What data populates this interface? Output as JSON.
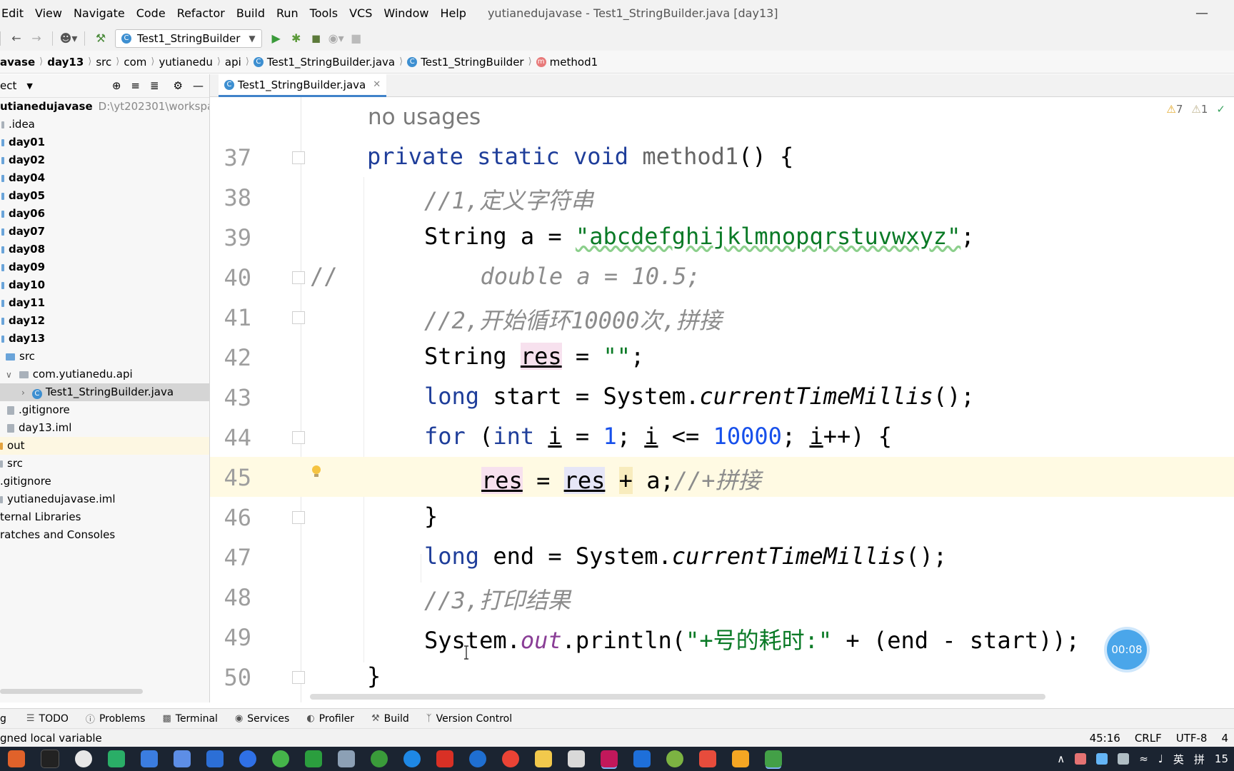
{
  "menu": {
    "items": [
      "Edit",
      "View",
      "Navigate",
      "Code",
      "Refactor",
      "Build",
      "Run",
      "Tools",
      "VCS",
      "Window",
      "Help"
    ],
    "window_title": "yutianedujavase - Test1_StringBuilder.java [day13]"
  },
  "toolbar": {
    "run_config": "Test1_StringBuilder"
  },
  "breadcrumb": [
    "avase",
    "day13",
    "src",
    "com",
    "yutianedu",
    "api",
    "Test1_StringBuilder.java",
    "Test1_StringBuilder",
    "method1"
  ],
  "project": {
    "header": "ect",
    "root_name": "utianedujavase",
    "root_path": "D:\\yt202301\\workspace\\",
    "tree": [
      ".idea",
      "day01",
      "day02",
      "day04",
      "day05",
      "day06",
      "day07",
      "day08",
      "day09",
      "day10",
      "day11",
      "day12",
      "day13",
      "src",
      "com.yutianedu.api",
      "Test1_StringBuilder.java",
      ".gitignore",
      "day13.iml",
      "out",
      "src",
      ".gitignore",
      "yutianedujavase.iml",
      "ternal Libraries",
      "ratches and Consoles"
    ]
  },
  "editor": {
    "tab": "Test1_StringBuilder.java",
    "hint": "no usages",
    "inspections": {
      "warnings": "7",
      "weak_warnings": "1"
    },
    "line_numbers": [
      "37",
      "38",
      "39",
      "40",
      "41",
      "42",
      "43",
      "44",
      "45",
      "46",
      "47",
      "48",
      "49",
      "50"
    ],
    "code": {
      "l37_kw1": "private",
      "l37_kw2": "static",
      "l37_kw3": "void",
      "l37_fn": "method1",
      "l37_rest": "() {",
      "l38_comment": "//1,定义字符串",
      "l39_type": "String a = ",
      "l39_str": "\"abcdefghijklmnopqrstuvwxyz\"",
      "l39_end": ";",
      "l40_slashes": "//",
      "l40_comment": "  double a = 10.5;",
      "l41_comment": "//2,开始循环10000次,拼接",
      "l42_a": "String ",
      "l42_res": "res",
      "l42_b": " = ",
      "l42_str": "\"\"",
      "l42_end": ";",
      "l43_kw": "long",
      "l43_a": " start = System.",
      "l43_m": "currentTimeMillis",
      "l43_end": "();",
      "l44_for": "for",
      "l44_a": " (",
      "l44_int": "int",
      "l44_sp": " ",
      "l44_i1": "i",
      "l44_b": " = ",
      "l44_n1": "1",
      "l44_c": "; ",
      "l44_i2": "i",
      "l44_d": " <= ",
      "l44_n2": "10000",
      "l44_e": "; ",
      "l44_i3": "i",
      "l44_f": "++) {",
      "l45_res1": "res",
      "l45_a": " = ",
      "l45_res2": "res",
      "l45_sp": " ",
      "l45_plus": "+",
      "l45_b": " a;",
      "l45_comment": "//+拼接",
      "l46": "}",
      "l47_kw": "long",
      "l47_a": " end = System.",
      "l47_m": "currentTimeMillis",
      "l47_end": "();",
      "l48_comment": "//3,打印结果",
      "l49_a": "System.",
      "l49_out": "out",
      "l49_b": ".println(",
      "l49_str": "\"+号的耗时:\"",
      "l49_c": " + (end - start));",
      "l50": "}"
    }
  },
  "timer": "00:08",
  "toolwindows": [
    "g",
    "TODO",
    "Problems",
    "Terminal",
    "Services",
    "Profiler",
    "Build",
    "Version Control"
  ],
  "status": {
    "message": "gned local variable",
    "position": "45:16",
    "line_sep": "CRLF",
    "encoding": "UTF-8",
    "indent": "4"
  },
  "taskbar": {
    "ime": "英",
    "ime2": "拼",
    "clock": "15"
  },
  "colors": {
    "accent": "#4083c9",
    "keyword": "#1f3e9a",
    "string": "#0a7a26",
    "number": "#1750eb",
    "comment": "#8c8c8c",
    "current_line": "#fffae3"
  }
}
